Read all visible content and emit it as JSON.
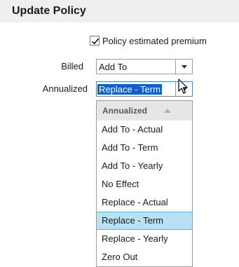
{
  "header": {
    "title": "Update Policy"
  },
  "policy_estimated": {
    "label": "Policy estimated premium",
    "checked": true
  },
  "billed": {
    "label": "Billed",
    "value": "Add To"
  },
  "annualized": {
    "label": "Annualized",
    "value": "Replace - Term"
  },
  "dropdown": {
    "header": "Annualized",
    "items": [
      "Add To - Actual",
      "Add To - Term",
      "Add To - Yearly",
      "No Effect",
      "Replace - Actual",
      "Replace - Term",
      "Replace - Yearly",
      "Zero Out"
    ],
    "highlighted": "Replace - Term"
  },
  "colors": {
    "header_bg": "#efefef",
    "selection_bg": "#0f5fd2",
    "highlight_bg": "#b8e2f3",
    "highlight_border": "#55b7e0"
  }
}
